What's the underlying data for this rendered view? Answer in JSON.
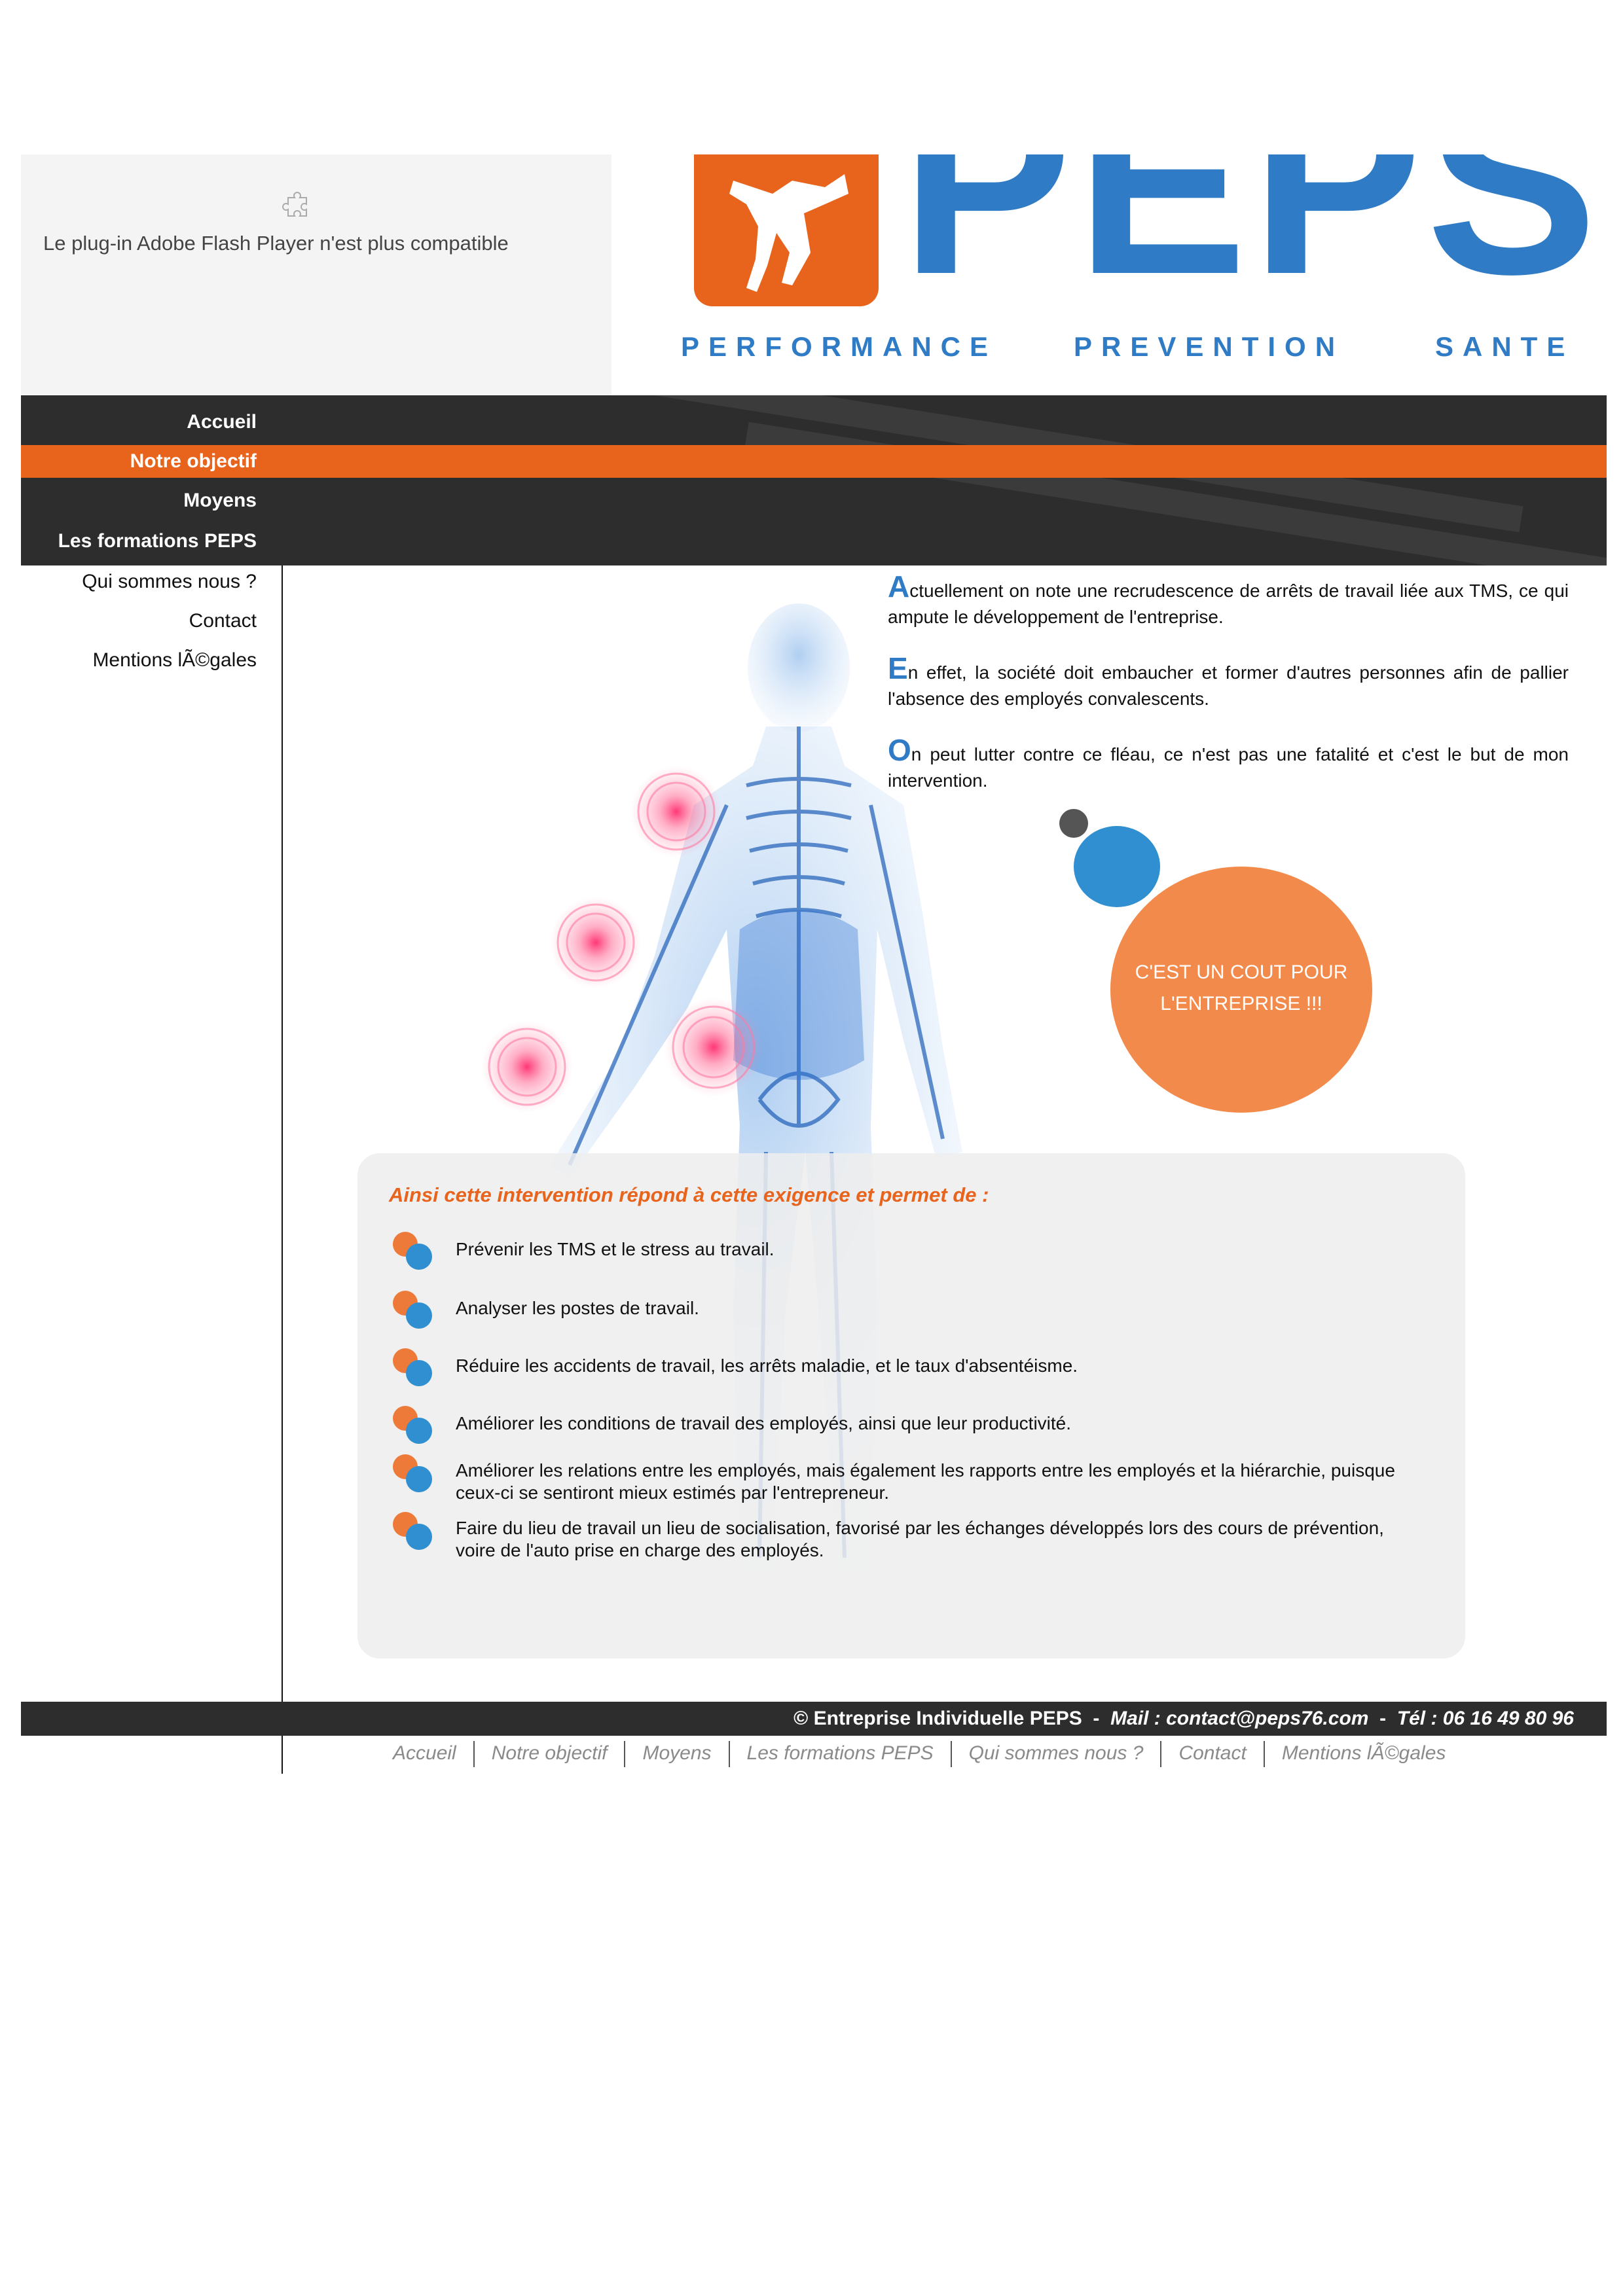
{
  "flash": {
    "message": "Le plug-in Adobe Flash Player n'est plus compatible",
    "icon": "puzzle-piece-icon"
  },
  "logo": {
    "word": "PEPS",
    "tagline": [
      "PERFORMANCE",
      "PREVENTION",
      "SANTE"
    ],
    "brand_blue": "#2f7bc5",
    "brand_orange": "#e8641d"
  },
  "nav": {
    "items": [
      "Accueil",
      "Notre objectif",
      "Moyens",
      "Les formations PEPS"
    ],
    "active": "Notre objectif"
  },
  "subnav": {
    "items": [
      "Qui sommes nous ?",
      "Contact",
      "Mentions lÃ©gales"
    ]
  },
  "intro": {
    "paragraphs": [
      {
        "cap": "A",
        "text": "ctuellement on note une recrudescence de arrêts de travail liée aux TMS, ce qui ampute le développement de l'entreprise."
      },
      {
        "cap": "E",
        "text": "n effet, la société doit embaucher et former d'autres personnes afin de pallier l'absence des employés convalescents."
      },
      {
        "cap": "O",
        "text": "n peut lutter contre ce fléau, ce n'est pas une fatalité et c'est le but de mon intervention."
      }
    ]
  },
  "bubble": {
    "line1": "C'EST UN COUT POUR",
    "line2": "L'ENTREPRISE !!!"
  },
  "panel": {
    "title": "Ainsi cette intervention répond à cette exigence et permet de :",
    "benefits": [
      "Prévenir les TMS et le stress au travail.",
      "Analyser les postes de travail.",
      "Réduire les accidents de travail, les arrêts maladie, et le taux d'absentéisme.",
      "Améliorer les conditions de travail des employés, ainsi que leur productivité.",
      "Améliorer les relations entre les employés, mais également les rapports entre les employés et la hiérarchie, puisque ceux-ci se sentiront mieux estimés par l'entrepreneur.",
      "Faire du lieu de travail un lieu de socialisation, favorisé par les échanges développés lors des cours de prévention, voire de l'auto prise en charge des employés."
    ]
  },
  "footer": {
    "company": "© Entreprise Individuelle PEPS",
    "mail": "Mail : contact@peps76.com",
    "phone": "Tél : 06 16 49 80 96",
    "separator": "-",
    "links": [
      "Accueil",
      "Notre objectif",
      "Moyens",
      "Les formations PEPS",
      "Qui sommes nous ?",
      "Contact",
      "Mentions lÃ©gales"
    ]
  }
}
